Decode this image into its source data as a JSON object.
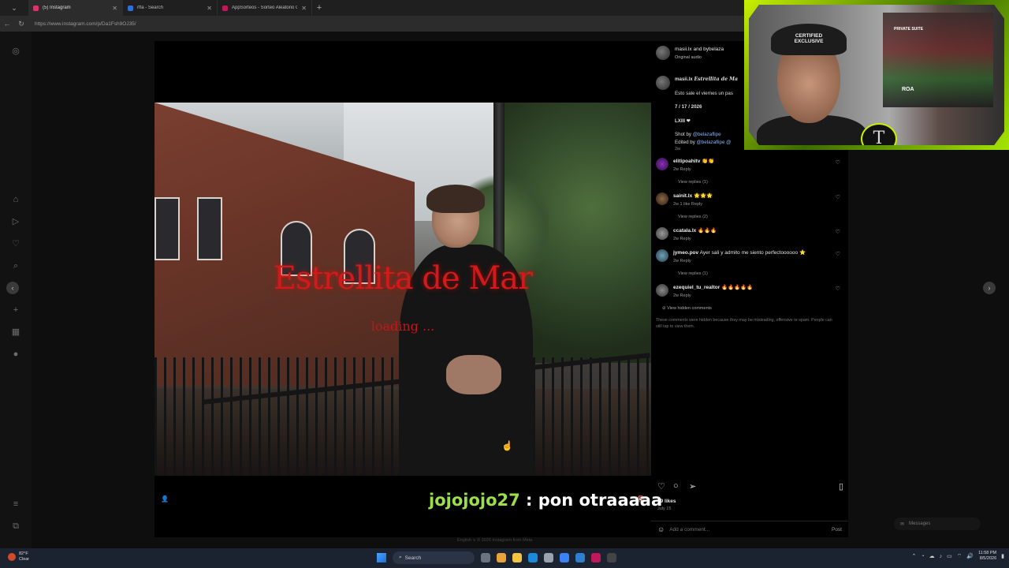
{
  "browser": {
    "tabs": [
      {
        "label": "(5) Instagram",
        "color": "#e1306c",
        "active": true
      },
      {
        "label": "rffa - Search",
        "color": "#2f6fd6",
        "active": false
      },
      {
        "label": "AppSorteos - Sorteo Aleatorio Gr...",
        "color": "#c2185b",
        "active": false
      }
    ],
    "new_tab": "+",
    "url": "https://www.instagram.com/p/Da1Fsh9OJ35/"
  },
  "video": {
    "title_overlay": "Estrellita de Mar",
    "loading_overlay": "loading ..."
  },
  "stream_chat": {
    "user": "jojojojo27",
    "message": " : pon otraaaaa"
  },
  "post": {
    "header_user": "masii.lx and bybelaza",
    "header_audio": "Original audio",
    "caption_user": "masii.lx",
    "caption_title": "Estrellita de Ma",
    "caption_line1": "Esto sale el viernes un pas",
    "caption_date": "7 / 17 / 2026",
    "caption_lxiii": "LXIII ❤",
    "caption_shot": "Shot by ",
    "caption_shot_link": "@belazaflipe",
    "caption_edit": "Edited by ",
    "caption_edit_link": "@belazaflipe @",
    "caption_age": "2w",
    "comments": [
      {
        "user": "elitipoahitv",
        "text": " 👏👏",
        "meta": "2w   Reply",
        "replies": "View replies (1)"
      },
      {
        "user": "sainit.lx",
        "text": " 🌟🌟🌟",
        "meta": "2w   1 like   Reply",
        "replies": "View replies (2)"
      },
      {
        "user": "ccatala.lx",
        "text": " 🔥🔥🔥",
        "meta": "2w   Reply",
        "replies": ""
      },
      {
        "user": "jymeo.pov",
        "text": " Ayer sali y admito me siento perfectoooooo ⭐",
        "meta": "2w   Reply",
        "replies": "View replies (1)"
      },
      {
        "user": "ezequiel_tu_realtor",
        "text": " 🔥🔥🔥🔥🔥",
        "meta": "2w   Reply",
        "replies": ""
      }
    ],
    "hidden_label": "View hidden comments",
    "hidden_note": "These comments were hidden because they may be misleading, offensive or spam. People can still tap to view them.",
    "likes": "99 likes",
    "date": "July 15",
    "add_comment_placeholder": "Add a comment...",
    "post_button": "Post"
  },
  "footer": "English  ∨    © 2026 Instagram from Meta",
  "messages_label": "Messages",
  "webcam": {
    "cap_text": "CERTIFIED EXCLUSIVE",
    "sign_text": "PRIVATE SUITE",
    "sign2_text": "ROA",
    "logo": "T"
  },
  "taskbar": {
    "temp": "82°F",
    "weather": "Clear",
    "search": "Search",
    "time": "11:58 PM",
    "date": "8/5/2026"
  }
}
